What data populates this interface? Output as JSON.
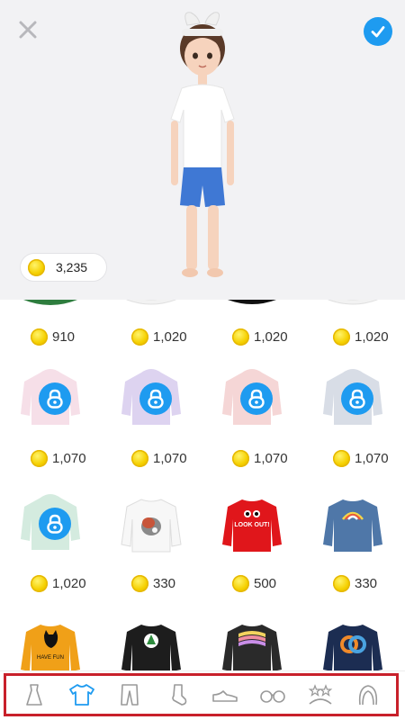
{
  "header": {
    "close_icon": "close-icon",
    "confirm_icon": "check-icon",
    "accent_color": "#1e9bf0"
  },
  "wallet": {
    "balance": "3,235",
    "icon": "coin-icon"
  },
  "items": [
    {
      "price": "910",
      "item": "green-top",
      "locked": false
    },
    {
      "price": "1,020",
      "item": "white-top",
      "locked": false
    },
    {
      "price": "1,020",
      "item": "black-top",
      "locked": false
    },
    {
      "price": "1,020",
      "item": "white-top",
      "locked": false
    },
    {
      "price": "1,070",
      "item": "pink-hoodie",
      "color": "#f6dfe8",
      "locked": true
    },
    {
      "price": "1,070",
      "item": "lavender-hoodie",
      "color": "#ddd3f0",
      "locked": true
    },
    {
      "price": "1,070",
      "item": "peach-hoodie",
      "color": "#f5d6d6",
      "locked": true
    },
    {
      "price": "1,070",
      "item": "grey-blue-hoodie",
      "color": "#d8dde6",
      "locked": true
    },
    {
      "price": "1,020",
      "item": "mint-hoodie",
      "color": "#d4ebdf",
      "locked": true
    },
    {
      "price": "330",
      "item": "white-animal-sweatshirt",
      "color": "#f7f7f7",
      "locked": false
    },
    {
      "price": "500",
      "item": "red-look-out-sweatshirt",
      "color": "#e0161b",
      "print": "LOOK OUT!",
      "locked": false
    },
    {
      "price": "330",
      "item": "blue-rainbow-sweatshirt",
      "color": "#4f77a8",
      "locked": false
    },
    {
      "price": "",
      "item": "orange-cat-sweatshirt",
      "color": "#f0a018",
      "print": "HAVE FUN",
      "locked": false
    },
    {
      "price": "",
      "item": "black-tree-sweatshirt",
      "color": "#1d1d1d",
      "locked": false
    },
    {
      "price": "",
      "item": "black-wave-sweatshirt",
      "color": "#2a2a2a",
      "locked": false
    },
    {
      "price": "",
      "item": "navy-circles-sweatshirt",
      "color": "#1c2d52",
      "locked": false
    }
  ],
  "tabs": [
    {
      "icon": "dress-icon",
      "active": false
    },
    {
      "icon": "tshirt-icon",
      "active": true
    },
    {
      "icon": "pants-icon",
      "active": false
    },
    {
      "icon": "sock-icon",
      "active": false
    },
    {
      "icon": "shoe-icon",
      "active": false
    },
    {
      "icon": "glasses-icon",
      "active": false
    },
    {
      "icon": "tiara-icon",
      "active": false
    },
    {
      "icon": "hair-icon",
      "active": false
    }
  ],
  "tab_colors": {
    "active": "#1e9bf0",
    "inactive": "#9a9a9a"
  }
}
